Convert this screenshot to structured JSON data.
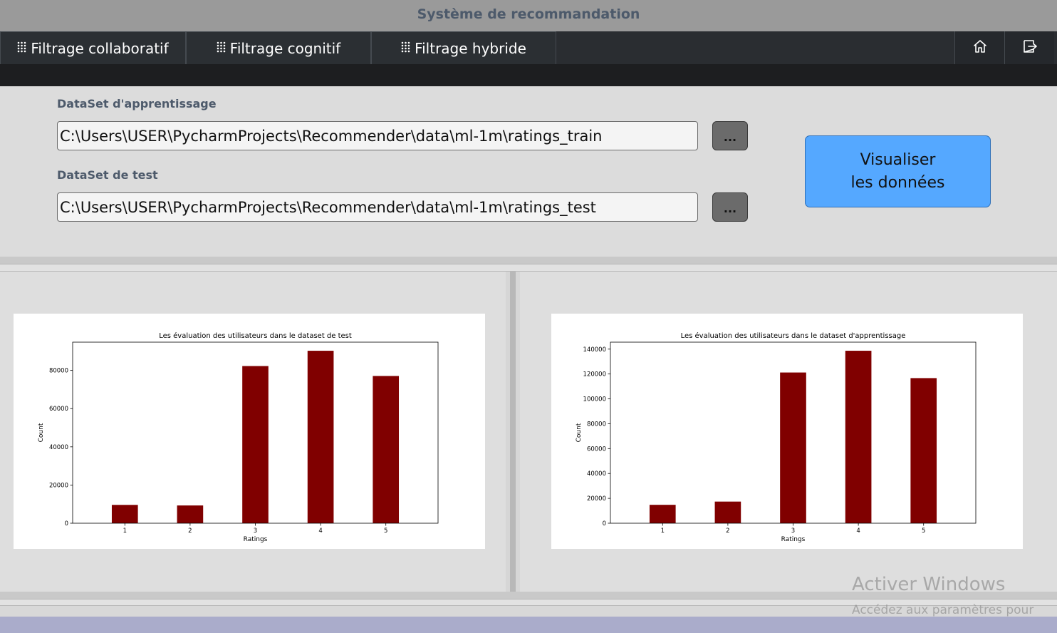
{
  "window": {
    "title": "Système de recommandation"
  },
  "nav": {
    "tabs": [
      {
        "label": "Filtrage collaboratif",
        "icon": "grid-icon"
      },
      {
        "label": "Filtrage cognitif",
        "icon": "grid-icon"
      },
      {
        "label": "Filtrage hybride",
        "icon": "grid-icon"
      }
    ],
    "buttons": [
      {
        "icon": "home-icon"
      },
      {
        "icon": "logout-icon"
      }
    ]
  },
  "form": {
    "train_label": "DataSet d'apprentissage",
    "train_path": "C:\\Users\\USER\\PycharmProjects\\Recommender\\data\\ml-1m\\ratings_train",
    "test_label": "DataSet de test",
    "test_path": "C:\\Users\\USER\\PycharmProjects\\Recommender\\data\\ml-1m\\ratings_test",
    "browse_label": "...",
    "visualize_label_line1": "Visualiser",
    "visualize_label_line2": "les données"
  },
  "colors": {
    "bar": "#800000",
    "visualize_button": "#55a8ff",
    "nav_background": "#2a2d31",
    "title_text": "#4d5a6b"
  },
  "chart_data": [
    {
      "type": "bar",
      "title": "Les évaluation des utilisateurs dans le dataset de test",
      "xlabel": "Ratings",
      "ylabel": "Count",
      "categories": [
        "1",
        "2",
        "3",
        "4",
        "5"
      ],
      "values": [
        9600,
        9300,
        82300,
        90300,
        77100
      ],
      "ylim": [
        0,
        94800
      ],
      "yticks": [
        0,
        20000,
        40000,
        60000,
        80000
      ],
      "grid": false
    },
    {
      "type": "bar",
      "title": "Les évaluation des utilisateurs dans le dataset d'apprentissage",
      "xlabel": "Ratings",
      "ylabel": "Count",
      "categories": [
        "1",
        "2",
        "3",
        "4",
        "5"
      ],
      "values": [
        14800,
        17400,
        121200,
        138700,
        116700
      ],
      "ylim": [
        0,
        145600
      ],
      "yticks": [
        0,
        20000,
        40000,
        60000,
        80000,
        100000,
        120000,
        140000
      ],
      "grid": false
    }
  ],
  "watermark": {
    "line1": "Activer Windows",
    "line2": "Accédez aux paramètres pour"
  }
}
